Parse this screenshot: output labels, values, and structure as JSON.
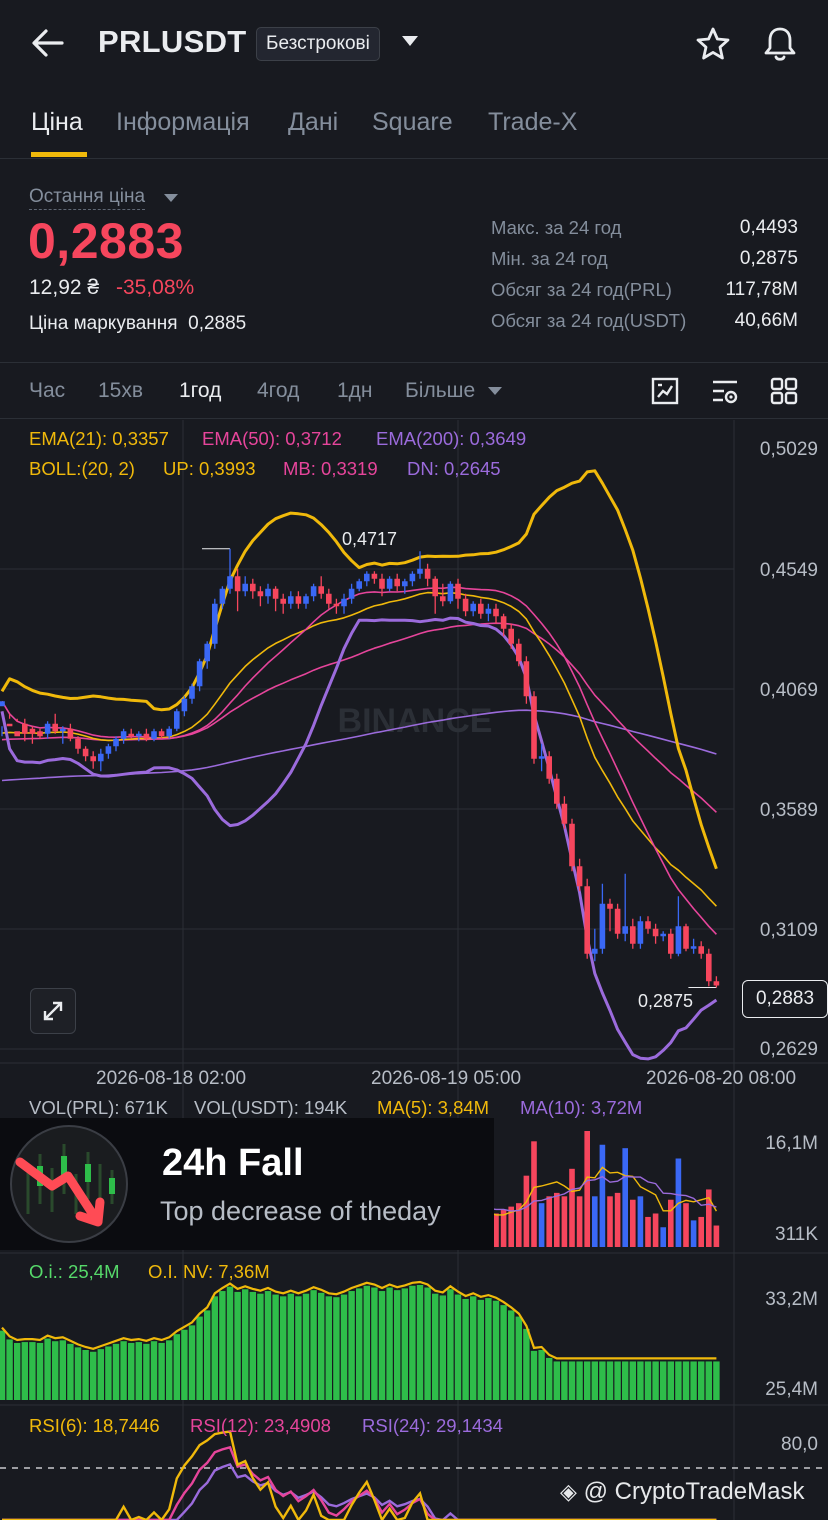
{
  "header": {
    "symbol": "PRLUSDT",
    "contract_type": "Безстрокові",
    "icons": {
      "back": "arrow-left-icon",
      "favorite": "star-icon",
      "alerts": "bell-icon"
    }
  },
  "tabs": [
    {
      "label": "Ціна",
      "active": true
    },
    {
      "label": "Інформація",
      "active": false
    },
    {
      "label": "Дані",
      "active": false
    },
    {
      "label": "Square",
      "active": false
    },
    {
      "label": "Trade-X",
      "active": false
    }
  ],
  "price_panel": {
    "last_price_label": "Остання ціна",
    "last_price": "0,2883",
    "fiat_price": "12,92 ₴",
    "change_percent": "-35,08%",
    "mark_price_label": "Ціна маркування",
    "mark_price": "0,2885",
    "stats": [
      {
        "label": "Макс. за 24 год",
        "value": "0,4493"
      },
      {
        "label": "Мін. за 24 год",
        "value": "0,2875"
      },
      {
        "label": "Обсяг за 24 год(PRL)",
        "value": "117,78M"
      },
      {
        "label": "Обсяг за 24 год(USDT)",
        "value": "40,66M"
      }
    ]
  },
  "timeframes": [
    {
      "label": "Час",
      "active": false
    },
    {
      "label": "15хв",
      "active": false
    },
    {
      "label": "1год",
      "active": true
    },
    {
      "label": "4год",
      "active": false
    },
    {
      "label": "1дн",
      "active": false
    },
    {
      "label": "Більше",
      "active": false
    }
  ],
  "chart_tools": [
    "chart-style-icon",
    "indicator-settings-icon",
    "grid-layout-icon"
  ],
  "colors": {
    "up": "#3a68f5",
    "down": "#f6465d",
    "accent": "#f0b90b",
    "ema50": "#e6459b",
    "ema200": "#9b6bdc",
    "oi_bar": "#2ebd4a",
    "oi_label": "#56d96a"
  },
  "chart_data": {
    "type": "candlestick",
    "legend_ema": [
      {
        "text": "EMA(21): 0,3357",
        "color": "#f0b90b"
      },
      {
        "text": "EMA(50): 0,3712",
        "color": "#e6459b"
      },
      {
        "text": "EMA(200): 0,3649",
        "color": "#9b6bdc"
      }
    ],
    "legend_boll": [
      {
        "text": "BOLL:(20, 2)",
        "color": "#f0b90b"
      },
      {
        "text": "UP: 0,3993",
        "color": "#f0b90b"
      },
      {
        "text": "MB: 0,3319",
        "color": "#e6459b"
      },
      {
        "text": "DN: 0,2645",
        "color": "#9b6bdc"
      }
    ],
    "y_ticks": [
      "0,5029",
      "0,4549",
      "0,4069",
      "0,3589",
      "0,3109",
      "0,2629"
    ],
    "y_tick_values": [
      0.5029,
      0.4549,
      0.4069,
      0.3589,
      0.3109,
      0.2629
    ],
    "x_ticks": [
      "2026-08-18 02:00",
      "2026-08-19 05:00",
      "2026-08-20 08:00"
    ],
    "high_label": "0,4717",
    "low_label": "0,2875",
    "current_price": "0,2883",
    "watermark": "BINANCE",
    "candles": [
      [
        0.4,
        0.402,
        0.392,
        0.388
      ],
      [
        0.393,
        0.392,
        0.397,
        0.395
      ],
      [
        0.39,
        0.388,
        0.395,
        0.394
      ],
      [
        0.393,
        0.389,
        0.395,
        0.386
      ],
      [
        0.391,
        0.389,
        0.392,
        0.385
      ],
      [
        0.39,
        0.388,
        0.391,
        0.387
      ],
      [
        0.389,
        0.393,
        0.394,
        0.387
      ],
      [
        0.393,
        0.39,
        0.397,
        0.389
      ],
      [
        0.39,
        0.391,
        0.392,
        0.385
      ],
      [
        0.391,
        0.387,
        0.393,
        0.386
      ],
      [
        0.387,
        0.383,
        0.388,
        0.381
      ],
      [
        0.383,
        0.38,
        0.384,
        0.378
      ],
      [
        0.38,
        0.378,
        0.382,
        0.375
      ],
      [
        0.378,
        0.381,
        0.383,
        0.374
      ],
      [
        0.381,
        0.384,
        0.385,
        0.379
      ],
      [
        0.384,
        0.387,
        0.388,
        0.382
      ],
      [
        0.387,
        0.39,
        0.391,
        0.385
      ],
      [
        0.389,
        0.388,
        0.391,
        0.387
      ],
      [
        0.388,
        0.389,
        0.39,
        0.386
      ],
      [
        0.389,
        0.387,
        0.391,
        0.386
      ],
      [
        0.387,
        0.39,
        0.391,
        0.386
      ],
      [
        0.39,
        0.388,
        0.391,
        0.387
      ],
      [
        0.388,
        0.391,
        0.392,
        0.387
      ],
      [
        0.391,
        0.398,
        0.399,
        0.39
      ],
      [
        0.398,
        0.403,
        0.404,
        0.396
      ],
      [
        0.403,
        0.408,
        0.409,
        0.401
      ],
      [
        0.408,
        0.418,
        0.419,
        0.406
      ],
      [
        0.418,
        0.425,
        0.426,
        0.415
      ],
      [
        0.425,
        0.441,
        0.443,
        0.423
      ],
      [
        0.441,
        0.447,
        0.448,
        0.439
      ],
      [
        0.447,
        0.452,
        0.463,
        0.445
      ],
      [
        0.452,
        0.446,
        0.455,
        0.438
      ],
      [
        0.446,
        0.449,
        0.452,
        0.444
      ],
      [
        0.449,
        0.446,
        0.451,
        0.443
      ],
      [
        0.446,
        0.444,
        0.448,
        0.44
      ],
      [
        0.444,
        0.447,
        0.449,
        0.441
      ],
      [
        0.447,
        0.443,
        0.448,
        0.438
      ],
      [
        0.443,
        0.441,
        0.445,
        0.437
      ],
      [
        0.441,
        0.444,
        0.446,
        0.439
      ],
      [
        0.444,
        0.441,
        0.446,
        0.439
      ],
      [
        0.441,
        0.444,
        0.445,
        0.439
      ],
      [
        0.444,
        0.448,
        0.449,
        0.442
      ],
      [
        0.448,
        0.445,
        0.452,
        0.443
      ],
      [
        0.445,
        0.441,
        0.447,
        0.439
      ],
      [
        0.441,
        0.44,
        0.443,
        0.437
      ],
      [
        0.44,
        0.443,
        0.445,
        0.437
      ],
      [
        0.443,
        0.447,
        0.449,
        0.441
      ],
      [
        0.447,
        0.45,
        0.451,
        0.446
      ],
      [
        0.45,
        0.453,
        0.454,
        0.448
      ],
      [
        0.453,
        0.451,
        0.454,
        0.449
      ],
      [
        0.451,
        0.447,
        0.453,
        0.444
      ],
      [
        0.447,
        0.451,
        0.452,
        0.446
      ],
      [
        0.451,
        0.448,
        0.453,
        0.446
      ],
      [
        0.448,
        0.45,
        0.451,
        0.445
      ],
      [
        0.45,
        0.453,
        0.454,
        0.448
      ],
      [
        0.453,
        0.455,
        0.462,
        0.451
      ],
      [
        0.455,
        0.451,
        0.457,
        0.448
      ],
      [
        0.451,
        0.444,
        0.452,
        0.437
      ],
      [
        0.444,
        0.442,
        0.449,
        0.44
      ],
      [
        0.442,
        0.449,
        0.45,
        0.441
      ],
      [
        0.449,
        0.443,
        0.451,
        0.439
      ],
      [
        0.443,
        0.438,
        0.445,
        0.436
      ],
      [
        0.438,
        0.441,
        0.442,
        0.436
      ],
      [
        0.441,
        0.437,
        0.443,
        0.435
      ],
      [
        0.437,
        0.439,
        0.441,
        0.434
      ],
      [
        0.439,
        0.436,
        0.441,
        0.433
      ],
      [
        0.436,
        0.431,
        0.437,
        0.428
      ],
      [
        0.431,
        0.425,
        0.433,
        0.423
      ],
      [
        0.425,
        0.418,
        0.427,
        0.416
      ],
      [
        0.418,
        0.404,
        0.42,
        0.401
      ],
      [
        0.404,
        0.379,
        0.406,
        0.377
      ],
      [
        0.379,
        0.38,
        0.385,
        0.374
      ],
      [
        0.38,
        0.371,
        0.382,
        0.369
      ],
      [
        0.371,
        0.361,
        0.373,
        0.359
      ],
      [
        0.361,
        0.353,
        0.364,
        0.351
      ],
      [
        0.353,
        0.336,
        0.355,
        0.334
      ],
      [
        0.336,
        0.328,
        0.339,
        0.326
      ],
      [
        0.328,
        0.301,
        0.331,
        0.299
      ],
      [
        0.301,
        0.303,
        0.311,
        0.298
      ],
      [
        0.303,
        0.321,
        0.329,
        0.301
      ],
      [
        0.321,
        0.319,
        0.323,
        0.31
      ],
      [
        0.319,
        0.309,
        0.321,
        0.307
      ],
      [
        0.309,
        0.312,
        0.333,
        0.306
      ],
      [
        0.312,
        0.305,
        0.315,
        0.303
      ],
      [
        0.305,
        0.314,
        0.316,
        0.303
      ],
      [
        0.314,
        0.311,
        0.316,
        0.309
      ],
      [
        0.311,
        0.308,
        0.313,
        0.305
      ],
      [
        0.308,
        0.309,
        0.31,
        0.306
      ],
      [
        0.309,
        0.301,
        0.311,
        0.299
      ],
      [
        0.301,
        0.312,
        0.324,
        0.3
      ],
      [
        0.312,
        0.303,
        0.313,
        0.302
      ],
      [
        0.303,
        0.304,
        0.307,
        0.301
      ],
      [
        0.304,
        0.301,
        0.306,
        0.299
      ],
      [
        0.301,
        0.29,
        0.303,
        0.288
      ],
      [
        0.29,
        0.2883,
        0.292,
        0.2875
      ]
    ]
  },
  "volume_panel": {
    "legend": [
      {
        "text": "VOL(PRL): 671K",
        "color": "#b7bdc6"
      },
      {
        "text": "VOL(USDT): 194K",
        "color": "#b7bdc6"
      },
      {
        "text": "MA(5): 3,84M",
        "color": "#f0b90b"
      },
      {
        "text": "MA(10): 3,72M",
        "color": "#9b6bdc"
      }
    ],
    "y_ticks": [
      "16,1M",
      "311K"
    ]
  },
  "oi_panel": {
    "legend": [
      {
        "text": "O.i.: 25,4M",
        "color": "#56d96a"
      },
      {
        "text": "O.I. NV: 7,36M",
        "color": "#f0b90b"
      }
    ],
    "y_ticks": [
      "33,2M",
      "25,4M"
    ]
  },
  "rsi_panel": {
    "legend": [
      {
        "text": "RSI(6): 18,7446",
        "color": "#f0b90b"
      },
      {
        "text": "RSI(12): 23,4908",
        "color": "#e6459b"
      },
      {
        "text": "RSI(24): 29,1434",
        "color": "#9b6bdc"
      }
    ],
    "y_ticks": [
      "80,0"
    ]
  },
  "toast": {
    "title": "24h Fall",
    "subtitle": "Top decrease of theday"
  },
  "watermark_bottom": "@ CryptoTradeMask"
}
